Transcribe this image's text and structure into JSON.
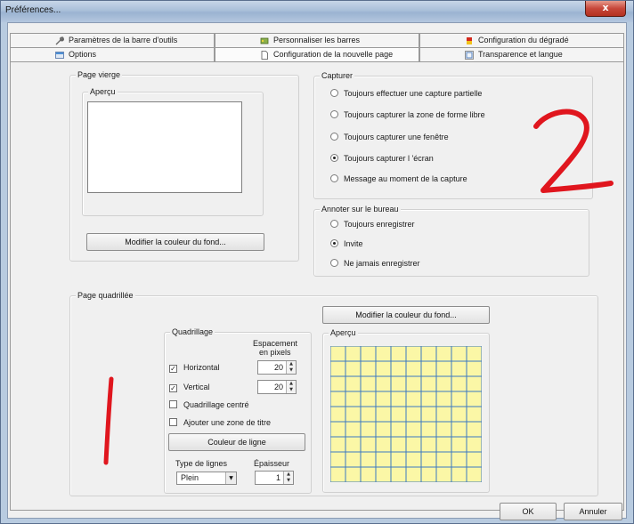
{
  "window": {
    "title": "Préférences...",
    "close_glyph": "x"
  },
  "tabs": {
    "row_back": [
      {
        "label": "Paramètres de la barre d'outils",
        "icon": "wrench-icon"
      },
      {
        "label": "Personnaliser les barres",
        "icon": "bars-icon"
      },
      {
        "label": "Configuration du dégradé",
        "icon": "gradient-icon"
      }
    ],
    "row_front": [
      {
        "label": "Options",
        "icon": "options-icon"
      },
      {
        "label": "Configuration de la nouvelle page",
        "icon": "page-icon"
      },
      {
        "label": "Transparence et langue",
        "icon": "transparency-icon"
      }
    ]
  },
  "page_vierge": {
    "legend": "Page vierge",
    "preview_legend": "Aperçu",
    "button": "Modifier la couleur du fond..."
  },
  "capturer": {
    "legend": "Capturer",
    "options": [
      {
        "label": "Toujours effectuer une capture partielle",
        "selected": false
      },
      {
        "label": "Toujours capturer la zone de forme libre",
        "selected": false
      },
      {
        "label": "Toujours capturer une fenêtre",
        "selected": false
      },
      {
        "label": "Toujours capturer l 'écran",
        "selected": true
      },
      {
        "label": "Message au moment de la capture",
        "selected": false
      }
    ]
  },
  "annoter": {
    "legend": "Annoter sur le bureau",
    "options": [
      {
        "label": "Toujours enregistrer",
        "selected": false
      },
      {
        "label": "Invite",
        "selected": true
      },
      {
        "label": "Ne jamais enregistrer",
        "selected": false
      }
    ]
  },
  "page_quadrillee": {
    "legend": "Page quadrillée",
    "button": "Modifier la couleur du fond...",
    "preview_legend": "Aperçu",
    "grid_color": "#fbf7a6",
    "grid_line_color": "#3b78c2"
  },
  "quadrillage": {
    "legend": "Quadrillage",
    "spacing_header_1": "Espacement",
    "spacing_header_2": "en pixels",
    "horizontal": {
      "label": "Horizontal",
      "checked": true,
      "value": "20"
    },
    "vertical": {
      "label": "Vertical",
      "checked": true,
      "value": "20"
    },
    "centered": {
      "label": "Quadrillage centré",
      "checked": false
    },
    "title_zone": {
      "label": "Ajouter une zone de titre",
      "checked": false
    },
    "line_color_button": "Couleur de ligne",
    "line_type_label": "Type de lignes",
    "line_type_value": "Plein",
    "thickness_label": "Épaisseur",
    "thickness_value": "1"
  },
  "annotations": {
    "mark_1": "1",
    "mark_2": "2",
    "color": "#e0161e"
  },
  "footer": {
    "ok": "OK",
    "cancel": "Annuler"
  }
}
